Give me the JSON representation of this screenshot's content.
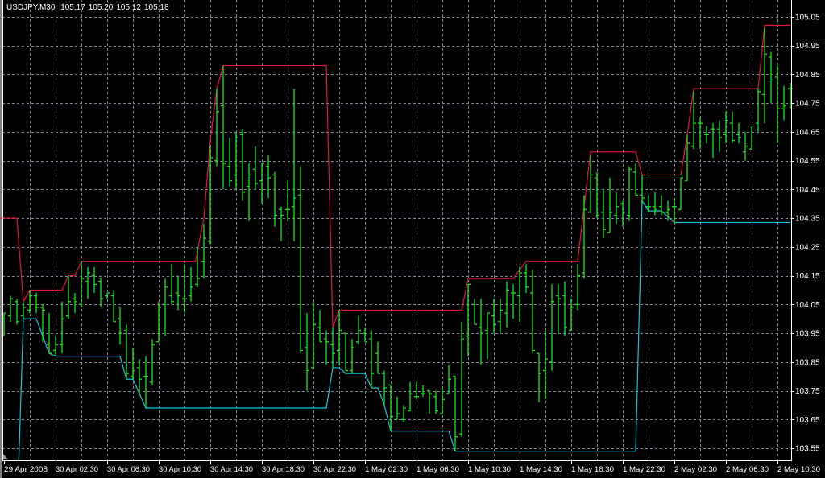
{
  "header": {
    "symbol": "USDJPY,M30",
    "open": "105.17",
    "high": "105.20",
    "low": "105.12",
    "close": "105.18"
  },
  "colors": {
    "background": "#000000",
    "bars": "#22e022",
    "upper_channel": "#e3163c",
    "lower_channel": "#14c8dc",
    "grid": "#778899",
    "axis": "#ffffff"
  },
  "chart_data": {
    "type": "ohlc",
    "title": "USDJPY,M30",
    "ylim": [
      103.5,
      105.1
    ],
    "grid": true,
    "yticks": [
      "105.05",
      "104.95",
      "104.85",
      "104.75",
      "104.65",
      "104.55",
      "104.45",
      "104.35",
      "104.25",
      "104.15",
      "104.05",
      "103.95",
      "103.85",
      "103.75",
      "103.65",
      "103.55"
    ],
    "xticks": [
      {
        "bar": 0,
        "label": "29 Apr 2008"
      },
      {
        "bar": 8,
        "label": "30 Apr 02:30"
      },
      {
        "bar": 16,
        "label": "30 Apr 06:30"
      },
      {
        "bar": 24,
        "label": "30 Apr 10:30"
      },
      {
        "bar": 32,
        "label": "30 Apr 14:30"
      },
      {
        "bar": 40,
        "label": "30 Apr 18:30"
      },
      {
        "bar": 48,
        "label": "30 Apr 22:30"
      },
      {
        "bar": 56,
        "label": "1 May 02:30"
      },
      {
        "bar": 64,
        "label": "1 May 06:30"
      },
      {
        "bar": 72,
        "label": "1 May 10:30"
      },
      {
        "bar": 80,
        "label": "1 May 14:30"
      },
      {
        "bar": 88,
        "label": "1 May 18:30"
      },
      {
        "bar": 96,
        "label": "1 May 22:30"
      },
      {
        "bar": 104,
        "label": "2 May 02:30"
      },
      {
        "bar": 112,
        "label": "2 May 06:30"
      },
      {
        "bar": 120,
        "label": "2 May 10:30"
      }
    ],
    "bars_ohlc": [
      [
        104.0,
        104.02,
        103.94,
        104.02
      ],
      [
        104.01,
        104.08,
        103.99,
        104.07
      ],
      [
        104.06,
        104.07,
        103.98,
        103.99
      ],
      [
        104.01,
        104.06,
        104.0,
        104.04
      ],
      [
        104.03,
        104.1,
        104.02,
        104.08
      ],
      [
        104.08,
        104.09,
        104.02,
        104.04
      ],
      [
        104.04,
        104.05,
        103.92,
        104.03
      ],
      [
        103.91,
        104.02,
        103.88,
        103.88
      ],
      [
        103.89,
        103.94,
        103.87,
        103.91
      ],
      [
        103.91,
        104.06,
        103.88,
        104.0
      ],
      [
        104.01,
        104.15,
        104.0,
        104.06
      ],
      [
        104.07,
        104.09,
        104.02,
        104.06
      ],
      [
        104.05,
        104.2,
        104.04,
        104.14
      ],
      [
        104.13,
        104.18,
        104.07,
        104.16
      ],
      [
        104.15,
        104.18,
        104.09,
        104.12
      ],
      [
        104.13,
        104.14,
        104.04,
        104.07
      ],
      [
        104.08,
        104.09,
        104.07,
        104.09
      ],
      [
        104.08,
        104.1,
        103.99,
        103.99
      ],
      [
        104.0,
        104.04,
        103.91,
        103.95
      ],
      [
        103.96,
        103.98,
        103.79,
        103.81
      ],
      [
        103.8,
        103.9,
        103.79,
        103.82
      ],
      [
        103.83,
        103.86,
        103.74,
        103.79
      ],
      [
        103.8,
        103.87,
        103.69,
        103.8
      ],
      [
        103.78,
        103.93,
        103.77,
        103.91
      ],
      [
        103.92,
        104.06,
        103.92,
        104.04
      ],
      [
        104.05,
        104.14,
        103.94,
        104.11
      ],
      [
        104.08,
        104.19,
        104.05,
        104.06
      ],
      [
        104.09,
        104.15,
        104.03,
        104.08
      ],
      [
        104.07,
        104.19,
        104.02,
        104.07
      ],
      [
        104.08,
        104.18,
        104.06,
        104.11
      ],
      [
        104.12,
        104.25,
        104.11,
        104.14
      ],
      [
        104.2,
        104.33,
        104.14,
        104.28
      ],
      [
        104.27,
        104.6,
        104.26,
        104.56
      ],
      [
        104.55,
        104.8,
        104.53,
        104.72
      ],
      [
        104.74,
        104.88,
        104.45,
        104.54
      ],
      [
        104.53,
        104.63,
        104.46,
        104.48
      ],
      [
        104.5,
        104.65,
        104.45,
        104.63
      ],
      [
        104.64,
        104.66,
        104.41,
        104.44
      ],
      [
        104.46,
        104.54,
        104.34,
        104.5
      ],
      [
        104.52,
        104.6,
        104.45,
        104.47
      ],
      [
        104.48,
        104.54,
        104.4,
        104.54
      ],
      [
        104.53,
        104.57,
        104.42,
        104.49
      ],
      [
        104.5,
        104.51,
        104.32,
        104.36
      ],
      [
        104.38,
        104.39,
        104.27,
        104.36
      ],
      [
        104.38,
        104.48,
        104.34,
        104.38
      ],
      [
        104.39,
        104.8,
        104.27,
        104.42
      ],
      [
        104.43,
        104.53,
        103.88,
        103.89
      ],
      [
        103.9,
        104.02,
        103.75,
        103.82
      ],
      [
        103.83,
        104.06,
        103.83,
        103.98
      ],
      [
        103.97,
        104.03,
        103.92,
        103.92
      ],
      [
        103.93,
        103.96,
        103.84,
        103.92
      ],
      [
        103.91,
        103.97,
        103.83,
        103.88
      ],
      [
        103.89,
        104.03,
        103.84,
        103.96
      ],
      [
        103.95,
        103.95,
        103.82,
        103.82
      ],
      [
        103.82,
        103.93,
        103.81,
        103.9
      ],
      [
        103.92,
        104.01,
        103.91,
        103.96
      ],
      [
        103.95,
        103.97,
        103.92,
        103.92
      ],
      [
        103.93,
        103.96,
        103.76,
        103.81
      ],
      [
        103.88,
        103.92,
        103.81,
        103.81
      ],
      [
        103.81,
        103.82,
        103.7,
        103.76
      ],
      [
        103.77,
        103.77,
        103.61,
        103.66
      ],
      [
        103.65,
        103.73,
        103.65,
        103.67
      ],
      [
        103.65,
        103.7,
        103.64,
        103.69
      ],
      [
        103.68,
        103.78,
        103.68,
        103.74
      ],
      [
        103.73,
        103.78,
        103.72,
        103.73
      ],
      [
        103.74,
        103.77,
        103.73,
        103.74
      ],
      [
        103.75,
        103.75,
        103.67,
        103.74
      ],
      [
        103.73,
        103.75,
        103.67,
        103.68
      ],
      [
        103.67,
        103.76,
        103.67,
        103.72
      ],
      [
        103.74,
        103.84,
        103.74,
        103.79
      ],
      [
        103.8,
        103.8,
        103.54,
        103.59
      ],
      [
        103.6,
        103.99,
        103.59,
        103.93
      ],
      [
        103.94,
        104.12,
        103.87,
        104.12
      ],
      [
        104.05,
        104.07,
        103.98,
        103.98
      ],
      [
        103.97,
        104.07,
        103.84,
        103.95
      ],
      [
        103.96,
        104.02,
        103.86,
        104.02
      ],
      [
        104.01,
        104.07,
        103.95,
        103.98
      ],
      [
        103.99,
        104.07,
        103.95,
        104.03
      ],
      [
        104.02,
        104.13,
        103.97,
        104.1
      ],
      [
        104.09,
        104.12,
        104.0,
        104.09
      ],
      [
        104.08,
        104.18,
        103.99,
        104.16
      ],
      [
        104.16,
        104.19,
        104.09,
        104.11
      ],
      [
        104.09,
        104.17,
        103.88,
        103.89
      ],
      [
        103.88,
        103.88,
        103.71,
        103.81
      ],
      [
        103.82,
        103.96,
        103.72,
        103.86
      ],
      [
        103.85,
        104.12,
        103.82,
        104.06
      ],
      [
        104.08,
        104.12,
        103.95,
        104.07
      ],
      [
        104.08,
        104.13,
        103.94,
        103.97
      ],
      [
        103.96,
        104.07,
        103.96,
        104.04
      ],
      [
        104.05,
        104.19,
        104.03,
        104.15
      ],
      [
        104.16,
        104.43,
        104.14,
        104.38
      ],
      [
        104.37,
        104.57,
        104.37,
        104.5
      ],
      [
        104.49,
        104.51,
        104.35,
        104.36
      ],
      [
        104.37,
        104.45,
        104.28,
        104.31
      ],
      [
        104.3,
        104.49,
        104.3,
        104.37
      ],
      [
        104.36,
        104.44,
        104.33,
        104.39
      ],
      [
        104.4,
        104.41,
        104.32,
        104.37
      ],
      [
        104.36,
        104.53,
        104.34,
        104.52
      ],
      [
        104.51,
        104.54,
        104.43,
        104.43
      ],
      [
        104.43,
        104.5,
        104.4,
        104.42
      ],
      [
        104.39,
        104.43,
        104.37,
        104.39
      ],
      [
        104.39,
        104.44,
        104.36,
        104.38
      ],
      [
        104.39,
        104.43,
        104.36,
        104.37
      ],
      [
        104.37,
        104.41,
        104.34,
        104.38
      ],
      [
        104.39,
        104.42,
        104.33,
        104.39
      ],
      [
        104.38,
        104.49,
        104.38,
        104.49
      ],
      [
        104.48,
        104.64,
        104.48,
        104.61
      ],
      [
        104.6,
        104.79,
        104.59,
        104.68
      ],
      [
        104.68,
        104.7,
        104.59,
        104.68
      ],
      [
        104.64,
        104.67,
        104.61,
        104.64
      ],
      [
        104.66,
        104.68,
        104.56,
        104.66
      ],
      [
        104.66,
        104.69,
        104.58,
        104.63
      ],
      [
        104.64,
        104.72,
        104.61,
        104.69
      ],
      [
        104.68,
        104.72,
        104.61,
        104.62
      ],
      [
        104.64,
        104.68,
        104.61,
        104.63
      ],
      [
        104.58,
        104.65,
        104.55,
        104.6
      ],
      [
        104.59,
        104.67,
        104.59,
        104.67
      ],
      [
        104.68,
        104.8,
        104.65,
        104.79
      ],
      [
        104.78,
        105.01,
        104.68,
        104.92
      ],
      [
        104.91,
        104.93,
        104.75,
        104.83
      ],
      [
        104.84,
        104.88,
        104.61,
        104.73
      ],
      [
        104.73,
        104.81,
        104.69,
        104.74
      ],
      [
        104.8,
        104.82,
        104.73,
        104.8
      ]
    ],
    "series": [
      {
        "name": "upper_channel",
        "points": [
          [
            -1,
            104.35
          ],
          [
            2,
            104.35
          ],
          [
            3,
            104.06
          ],
          [
            4,
            104.1
          ],
          [
            9,
            104.1
          ],
          [
            10,
            104.15
          ],
          [
            11,
            104.15
          ],
          [
            12,
            104.2
          ],
          [
            29.7,
            104.2
          ],
          [
            31,
            104.35
          ],
          [
            32,
            104.62
          ],
          [
            33,
            104.8
          ],
          [
            34,
            104.88
          ],
          [
            50,
            104.88
          ],
          [
            51,
            103.97
          ],
          [
            52,
            104.03
          ],
          [
            71,
            104.03
          ],
          [
            72,
            104.14
          ],
          [
            79,
            104.14
          ],
          [
            81,
            104.2
          ],
          [
            89,
            104.2
          ],
          [
            90,
            104.39
          ],
          [
            91,
            104.58
          ],
          [
            98,
            104.58
          ],
          [
            99,
            104.5
          ],
          [
            105,
            104.5
          ],
          [
            106,
            104.64
          ],
          [
            107,
            104.8
          ],
          [
            117,
            104.8
          ],
          [
            118,
            105.02
          ],
          [
            122,
            105.02
          ]
        ]
      },
      {
        "name": "lower_channel",
        "points": [
          [
            2.3,
            103.4
          ],
          [
            3,
            104.0
          ],
          [
            5,
            104.0
          ],
          [
            7,
            103.88
          ],
          [
            8,
            103.87
          ],
          [
            18,
            103.87
          ],
          [
            19,
            103.79
          ],
          [
            20,
            103.79
          ],
          [
            21,
            103.74
          ],
          [
            22,
            103.69
          ],
          [
            50,
            103.69
          ],
          [
            51,
            103.83
          ],
          [
            52,
            103.83
          ],
          [
            53,
            103.81
          ],
          [
            56,
            103.81
          ],
          [
            57,
            103.76
          ],
          [
            58,
            103.76
          ],
          [
            59,
            103.7
          ],
          [
            60,
            103.61
          ],
          [
            69,
            103.61
          ],
          [
            70,
            103.54
          ],
          [
            98,
            103.54
          ],
          [
            99,
            104.41
          ],
          [
            100,
            104.375
          ],
          [
            102,
            104.375
          ],
          [
            104,
            104.335
          ],
          [
            122,
            104.335
          ]
        ]
      }
    ]
  }
}
